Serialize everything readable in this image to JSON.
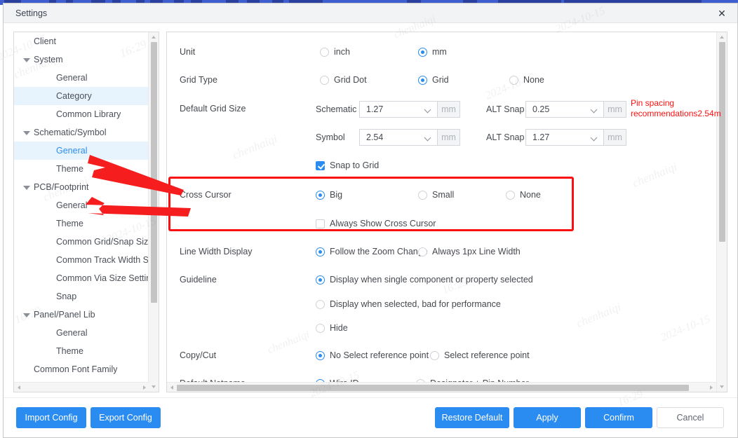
{
  "window": {
    "title": "Settings",
    "close_icon": "close-icon",
    "accent_color": "#2a8cf0",
    "annotation_color": "#fa1010"
  },
  "sidebar": {
    "items": [
      {
        "label": "Client",
        "level": 0,
        "expandable": false,
        "selected": false,
        "active": false
      },
      {
        "label": "System",
        "level": 0,
        "expandable": true,
        "selected": false,
        "active": false
      },
      {
        "label": "General",
        "level": 2,
        "expandable": false,
        "selected": false,
        "active": false
      },
      {
        "label": "Category",
        "level": 2,
        "expandable": false,
        "selected": true,
        "active": false
      },
      {
        "label": "Common Library",
        "level": 2,
        "expandable": false,
        "selected": false,
        "active": false
      },
      {
        "label": "Schematic/Symbol",
        "level": 0,
        "expandable": true,
        "selected": false,
        "active": false
      },
      {
        "label": "General",
        "level": 2,
        "expandable": false,
        "selected": true,
        "active": true
      },
      {
        "label": "Theme",
        "level": 2,
        "expandable": false,
        "selected": false,
        "active": false
      },
      {
        "label": "PCB/Footprint",
        "level": 0,
        "expandable": true,
        "selected": false,
        "active": false
      },
      {
        "label": "General",
        "level": 2,
        "expandable": false,
        "selected": false,
        "active": false
      },
      {
        "label": "Theme",
        "level": 2,
        "expandable": false,
        "selected": false,
        "active": false
      },
      {
        "label": "Common Grid/Snap Size Se",
        "level": 2,
        "expandable": false,
        "selected": false,
        "active": false
      },
      {
        "label": "Common Track Width Settin",
        "level": 2,
        "expandable": false,
        "selected": false,
        "active": false
      },
      {
        "label": "Common Via Size Setting",
        "level": 2,
        "expandable": false,
        "selected": false,
        "active": false
      },
      {
        "label": "Snap",
        "level": 2,
        "expandable": false,
        "selected": false,
        "active": false
      },
      {
        "label": "Panel/Panel Lib",
        "level": 0,
        "expandable": true,
        "selected": false,
        "active": false
      },
      {
        "label": "General",
        "level": 2,
        "expandable": false,
        "selected": false,
        "active": false
      },
      {
        "label": "Theme",
        "level": 2,
        "expandable": false,
        "selected": false,
        "active": false
      },
      {
        "label": "Common Font Family",
        "level": 1,
        "expandable": false,
        "selected": false,
        "active": false
      }
    ]
  },
  "settings": {
    "unit": {
      "label": "Unit",
      "options": [
        {
          "label": "inch",
          "selected": false
        },
        {
          "label": "mm",
          "selected": true
        }
      ]
    },
    "grid_type": {
      "label": "Grid Type",
      "options": [
        {
          "label": "Grid Dot",
          "selected": false
        },
        {
          "label": "Grid",
          "selected": true
        },
        {
          "label": "None",
          "selected": false
        }
      ]
    },
    "default_grid_size": {
      "label": "Default Grid Size",
      "schematic": {
        "label": "Schematic",
        "value": "1.27",
        "unit": "mm"
      },
      "symbol": {
        "label": "Symbol",
        "value": "2.54",
        "unit": "mm"
      },
      "alt_snap_1": {
        "label": "ALT Snap",
        "value": "0.25",
        "unit": "mm"
      },
      "alt_snap_2": {
        "label": "ALT Snap",
        "value": "1.27",
        "unit": "mm"
      }
    },
    "snap_to_grid": {
      "label": "Snap to Grid",
      "checked": true
    },
    "cross_cursor": {
      "label": "Cross Cursor",
      "options": [
        {
          "label": "Big",
          "selected": true
        },
        {
          "label": "Small",
          "selected": false
        },
        {
          "label": "None",
          "selected": false
        }
      ],
      "always_show": {
        "label": "Always Show Cross Cursor",
        "checked": false
      }
    },
    "line_width_display": {
      "label": "Line Width Display",
      "options": [
        {
          "label": "Follow the Zoom Change",
          "selected": true
        },
        {
          "label": "Always 1px Line Width",
          "selected": false
        }
      ]
    },
    "guideline": {
      "label": "Guideline",
      "options": [
        {
          "label": "Display when single component or property selected",
          "selected": true
        },
        {
          "label": "Display when selected, bad for performance",
          "selected": false
        },
        {
          "label": "Hide",
          "selected": false
        }
      ]
    },
    "copy_cut": {
      "label": "Copy/Cut",
      "options": [
        {
          "label": "No Select reference point",
          "selected": true
        },
        {
          "label": "Select reference point",
          "selected": false
        }
      ]
    },
    "default_netname": {
      "label": "Default Netname",
      "options": [
        {
          "label": "Wire ID",
          "selected": true
        },
        {
          "label": "Designator + Pin Number",
          "selected": false
        }
      ]
    }
  },
  "annotation": {
    "red_note": "Pin spacing\nrecommendations2.54m"
  },
  "footer": {
    "import_config": "Import Config",
    "export_config": "Export Config",
    "restore_default": "Restore Default",
    "apply": "Apply",
    "confirm": "Confirm",
    "cancel": "Cancel"
  },
  "watermarks": [
    "chenhaiqi",
    "2024-10-15",
    "16:29",
    "chenhaiqi",
    "2024-10-15",
    "16:29",
    "chenhaiqi",
    "2024-10-15",
    "chenhaiqi",
    "16:29",
    "2024-10-15",
    "chenhaiqi"
  ]
}
